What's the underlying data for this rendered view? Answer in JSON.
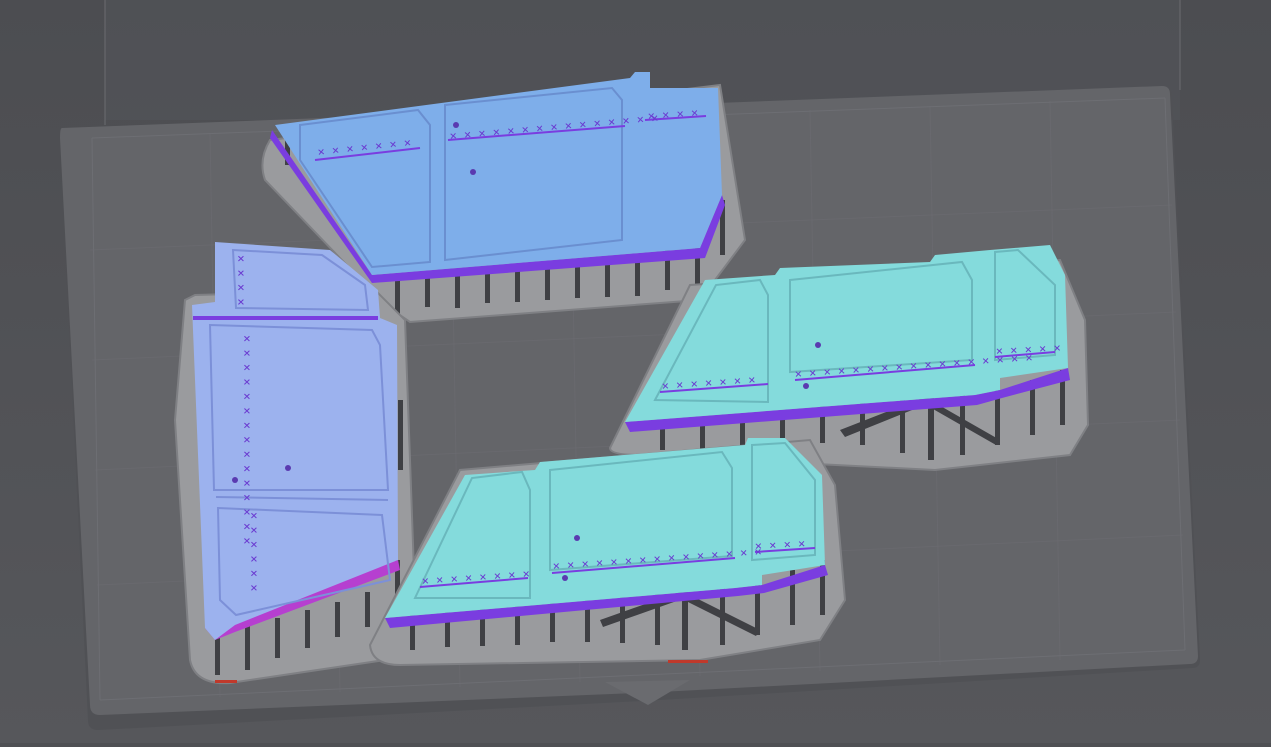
{
  "viewport": {
    "background": "#4f5054",
    "plate_color": "#646569",
    "plate_shadow": "#515255",
    "grid_color": "#6f7075"
  },
  "colors": {
    "part_blue": "#7eaeea",
    "part_blue_light": "#a6c3f1",
    "part_periwinkle": "#9cb2ee",
    "part_cyan": "#84dbdc",
    "part_cyan_light": "#a3eaea",
    "edge_purple": "#7a3de0",
    "edge_magenta": "#b63fd0",
    "raft": "#9a9b9e",
    "raft_edge": "#85868a",
    "support": "#3f4044"
  },
  "parts": [
    {
      "id": "part-top",
      "label_marks": "× × × × × × ×",
      "label_marks_2": "× × × × × × × × × × × × × × ×",
      "label_marks_3": "× × × ×"
    },
    {
      "id": "part-left",
      "label_marks": "× × × × × × × × × × × × × × ×",
      "label_marks_2": "× × × × × ×",
      "label_marks_3": "× × × ×"
    },
    {
      "id": "part-right",
      "label_marks": "× × × × × × ×",
      "label_marks_2": "× × × × × × × × × × × × × × × × ×",
      "label_marks_3": "× × × × ×"
    },
    {
      "id": "part-bottom",
      "label_marks": "× × × × × × × ×",
      "label_marks_2": "× × × × × × × × × × × × × × ×",
      "label_marks_3": "× × × ×"
    }
  ]
}
